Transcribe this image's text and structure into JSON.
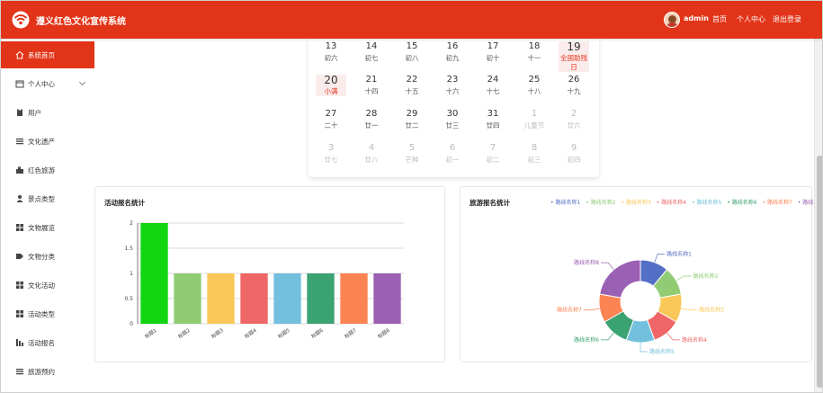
{
  "app": {
    "title": "遵义红色文化宣传系统"
  },
  "header": {
    "username": "admin",
    "nav": [
      "首页",
      "个人中心",
      "退出登录"
    ]
  },
  "sidebar": {
    "items": [
      {
        "label": "系统首页",
        "icon": "home-icon",
        "active": true
      },
      {
        "label": "个人中心",
        "icon": "calendar-icon",
        "expandable": true
      },
      {
        "label": "用户",
        "icon": "clipboard-icon"
      },
      {
        "label": "文化遗产",
        "icon": "list-icon"
      },
      {
        "label": "红色旅游",
        "icon": "flag-icon"
      },
      {
        "label": "景点类型",
        "icon": "person-icon"
      },
      {
        "label": "文物展览",
        "icon": "grid-icon"
      },
      {
        "label": "文物分类",
        "icon": "tag-icon"
      },
      {
        "label": "文化活动",
        "icon": "grid-icon"
      },
      {
        "label": "活动类型",
        "icon": "grid-icon"
      },
      {
        "label": "活动报名",
        "icon": "bar-chart-icon"
      },
      {
        "label": "旅游预约",
        "icon": "list-icon"
      }
    ]
  },
  "calendar": {
    "rows": [
      [
        {
          "n": "13",
          "l": "初六"
        },
        {
          "n": "14",
          "l": "初七"
        },
        {
          "n": "15",
          "l": "初八"
        },
        {
          "n": "16",
          "l": "初九"
        },
        {
          "n": "17",
          "l": "初十"
        },
        {
          "n": "18",
          "l": "十一"
        },
        {
          "n": "19",
          "l": "全国助残日",
          "hl": true,
          "red": true
        }
      ],
      [
        {
          "n": "20",
          "l": "小满",
          "hl": true,
          "red": true
        },
        {
          "n": "21",
          "l": "十四"
        },
        {
          "n": "22",
          "l": "十五"
        },
        {
          "n": "23",
          "l": "十六"
        },
        {
          "n": "24",
          "l": "十七"
        },
        {
          "n": "25",
          "l": "十八"
        },
        {
          "n": "26",
          "l": "十九"
        }
      ],
      [
        {
          "n": "27",
          "l": "二十"
        },
        {
          "n": "28",
          "l": "廿一"
        },
        {
          "n": "29",
          "l": "廿二"
        },
        {
          "n": "30",
          "l": "廿三"
        },
        {
          "n": "31",
          "l": "廿四"
        },
        {
          "n": "1",
          "l": "儿童节",
          "dim": true
        },
        {
          "n": "2",
          "l": "廿六",
          "dim": true
        }
      ],
      [
        {
          "n": "3",
          "l": "廿七",
          "dim": true
        },
        {
          "n": "4",
          "l": "廿八",
          "dim": true
        },
        {
          "n": "5",
          "l": "芒种",
          "dim": true
        },
        {
          "n": "6",
          "l": "初一",
          "dim": true
        },
        {
          "n": "7",
          "l": "初二",
          "dim": true
        },
        {
          "n": "8",
          "l": "初三",
          "dim": true
        },
        {
          "n": "9",
          "l": "初四",
          "dim": true
        }
      ]
    ]
  },
  "chart_data": [
    {
      "type": "bar",
      "title": "活动报名统计",
      "categories": [
        "标题1",
        "标题2",
        "标题3",
        "标题4",
        "标题5",
        "标题6",
        "标题7",
        "标题8"
      ],
      "values": [
        2,
        1,
        1,
        1,
        1,
        1,
        1,
        1
      ],
      "ylim": [
        0,
        2
      ],
      "yticks": [
        "0",
        "0.5",
        "1",
        "1.5",
        "2"
      ],
      "colors": [
        "#11d611",
        "#91cc75",
        "#fac858",
        "#ee6666",
        "#73c0de",
        "#3ba272",
        "#fc8452",
        "#9a60b4"
      ]
    },
    {
      "type": "pie",
      "title": "旅游报名统计",
      "labels": [
        "路线名称1",
        "路线名称2",
        "路线名称3",
        "路线名称4",
        "路线名称5",
        "路线名称6",
        "路线名称7",
        "路线名称8"
      ],
      "values": [
        1,
        1,
        1,
        1,
        1,
        1,
        1,
        2
      ],
      "colors": [
        "#5470c6",
        "#91cc75",
        "#fac858",
        "#ee6666",
        "#73c0de",
        "#3ba272",
        "#fc8452",
        "#9a60b4"
      ]
    }
  ]
}
